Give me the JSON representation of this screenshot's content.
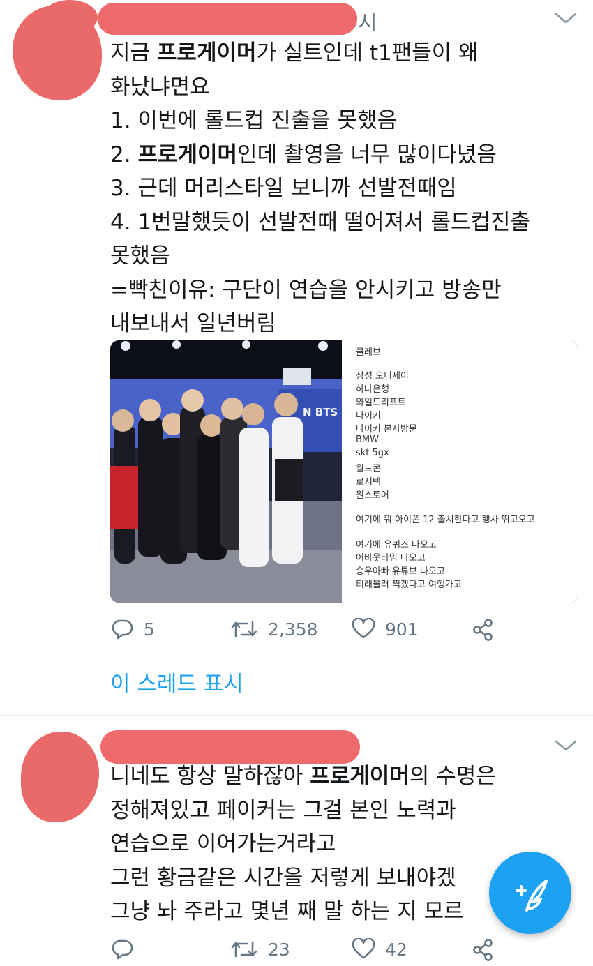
{
  "tweets": [
    {
      "header_tail": "시",
      "lines": [
        [
          {
            "t": "지금 "
          },
          {
            "t": "프로게이머",
            "b": true
          },
          {
            "t": "가 실트인데 t1팬들이 왜"
          }
        ],
        [
          {
            "t": "화났냐면요"
          }
        ],
        [
          {
            "t": "1. 이번에 롤드컵 진출을 못했음"
          }
        ],
        [
          {
            "t": "2. "
          },
          {
            "t": "프로게이머",
            "b": true
          },
          {
            "t": "인데 촬영을 너무 많이다녔음"
          }
        ],
        [
          {
            "t": "3. 근데 머리스타일 보니까 선발전때임"
          }
        ],
        [
          {
            "t": "4. 1번말했듯이 선발전때 떨어져서 롤드컵진출"
          }
        ],
        [
          {
            "t": "못했음"
          }
        ],
        [
          {
            "t": "=빡친이유: 구단이 연습을 안시키고 방송만"
          }
        ],
        [
          {
            "t": "내보내서 일년버림"
          }
        ]
      ],
      "media_notes": [
        "클레브",
        "",
        "삼성 오디세이",
        "하나은행",
        "와일드리프트",
        "나이키",
        "나이키 본사방문",
        "BMW",
        "skt 5gx",
        "월드콘",
        "로지텍",
        "원스토어",
        "",
        "여기에 뭐 아이폰 12 출시한다고 행사 뛰고오고",
        "",
        "여기에 유퀴즈 나오고",
        "어바웃타임 나오고",
        "승우아빠 유튜브 나오고",
        "티래블러 찍겠다고 여행가고"
      ],
      "photo_sign": "N BTS",
      "replies": "5",
      "retweets": "2,358",
      "likes": "901",
      "show_thread": "이 스레드 표시"
    },
    {
      "lines": [
        [
          {
            "t": "니네도 항상 말하잖아 "
          },
          {
            "t": "프로게이머",
            "b": true
          },
          {
            "t": "의 수명은"
          }
        ],
        [
          {
            "t": "정해져있고 페이커는 그걸 본인 노력과"
          }
        ],
        [
          {
            "t": "연습으로 이어가는거라고"
          }
        ],
        [
          {
            "t": "그런 황금같은 시간을 저렇게 보내야겠"
          }
        ],
        [
          {
            "t": "그냥 놔 주라고 몇년 째 말 하는 지 모르"
          }
        ]
      ],
      "retweets": "23",
      "likes": "42"
    }
  ],
  "colors": {
    "accent": "#1da1f2",
    "text": "#14171a",
    "muted": "#657786",
    "redaction": "#ef6b6b"
  },
  "icons": [
    "chevron-down-icon",
    "reply-icon",
    "retweet-icon",
    "like-icon",
    "share-icon",
    "compose-icon"
  ]
}
